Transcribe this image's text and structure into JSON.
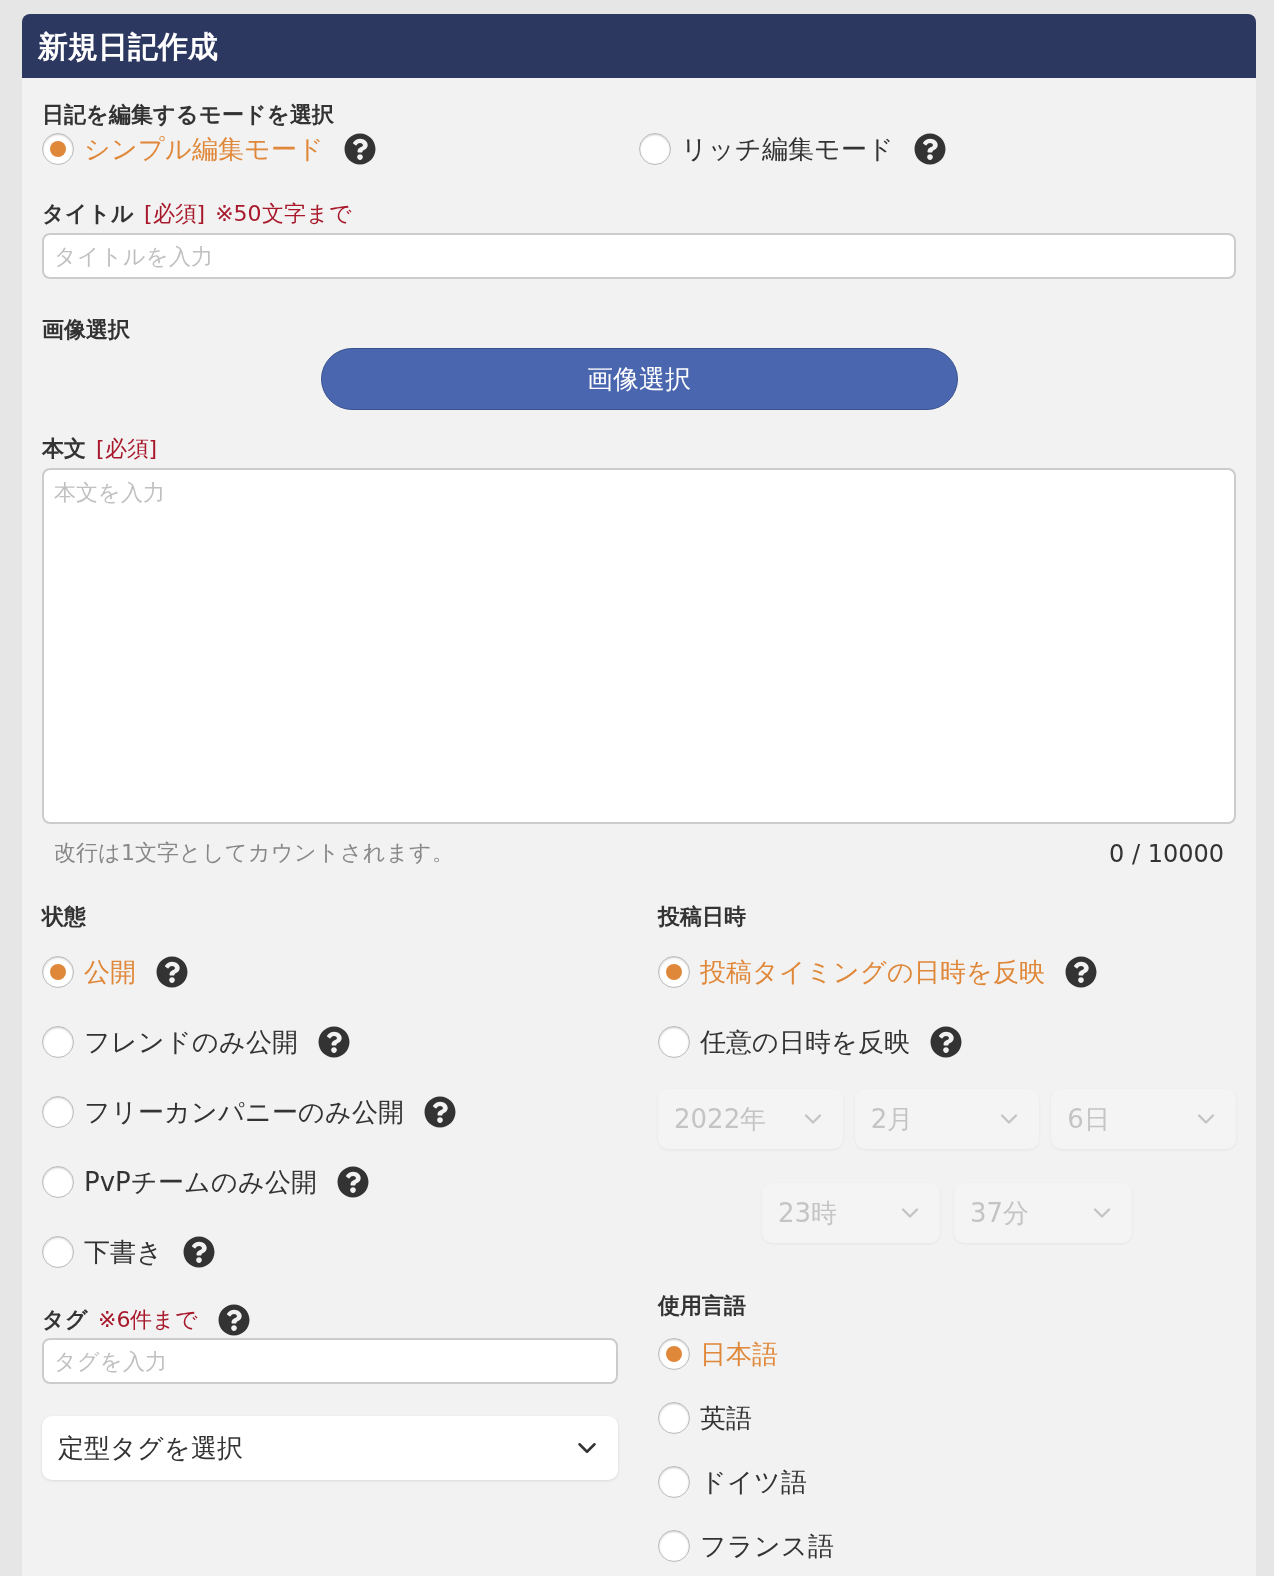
{
  "header": {
    "title": "新規日記作成"
  },
  "edit_mode": {
    "label": "日記を編集するモードを選択",
    "options": [
      {
        "label": "シンプル編集モード",
        "selected": true,
        "help": true
      },
      {
        "label": "リッチ編集モード",
        "selected": false,
        "help": true
      }
    ]
  },
  "title_field": {
    "label": "タイトル",
    "required": "[必須]",
    "note": "※50文字まで",
    "placeholder": "タイトルを入力"
  },
  "image": {
    "label": "画像選択",
    "button": "画像選択"
  },
  "body": {
    "label": "本文",
    "required": "[必須]",
    "placeholder": "本文を入力",
    "hint": "改行は1文字としてカウントされます。",
    "counter": "0 / 10000"
  },
  "status": {
    "label": "状態",
    "options": [
      {
        "label": "公開",
        "selected": true,
        "help": true
      },
      {
        "label": "フレンドのみ公開",
        "selected": false,
        "help": true
      },
      {
        "label": "フリーカンパニーのみ公開",
        "selected": false,
        "help": true
      },
      {
        "label": "PvPチームのみ公開",
        "selected": false,
        "help": true
      },
      {
        "label": "下書き",
        "selected": false,
        "help": true
      }
    ]
  },
  "post_date": {
    "label": "投稿日時",
    "options": [
      {
        "label": "投稿タイミングの日時を反映",
        "selected": true,
        "help": true
      },
      {
        "label": "任意の日時を反映",
        "selected": false,
        "help": true
      }
    ],
    "date_selects": [
      {
        "value": "2022年",
        "disabled": true
      },
      {
        "value": "2月",
        "disabled": true
      },
      {
        "value": "6日",
        "disabled": true
      }
    ],
    "time_selects": [
      {
        "value": "23時",
        "disabled": true
      },
      {
        "value": "37分",
        "disabled": true
      }
    ]
  },
  "tags": {
    "label": "タグ",
    "note": "※6件まで",
    "help": true,
    "placeholder": "タグを入力",
    "preset_select": "定型タグを選択"
  },
  "language": {
    "label": "使用言語",
    "options": [
      {
        "label": "日本語",
        "selected": true
      },
      {
        "label": "英語",
        "selected": false
      },
      {
        "label": "ドイツ語",
        "selected": false
      },
      {
        "label": "フランス語",
        "selected": false
      }
    ]
  }
}
